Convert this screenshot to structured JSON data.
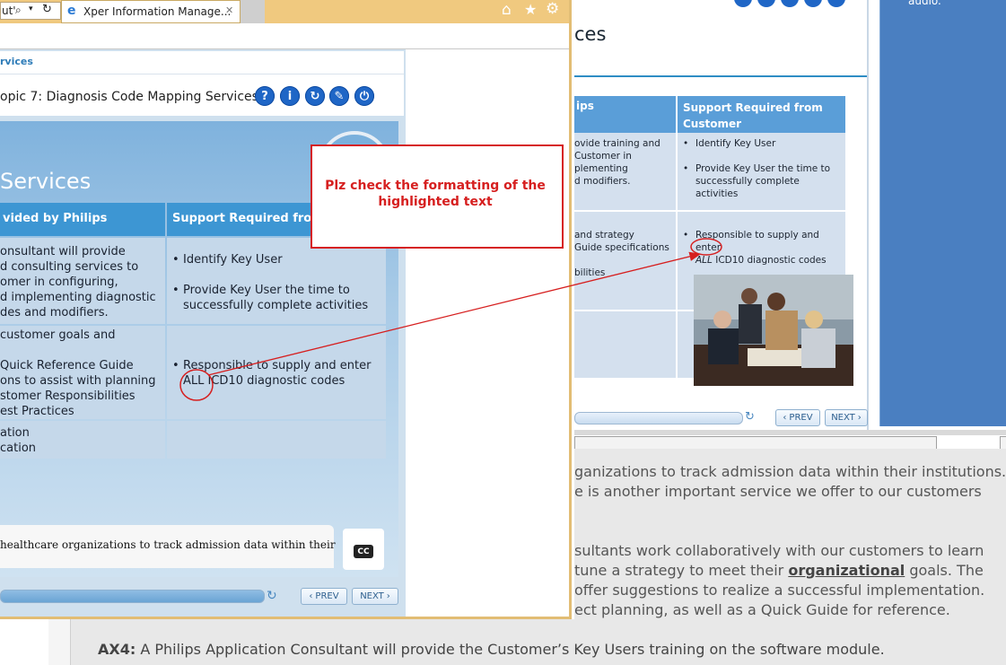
{
  "browser": {
    "address_snippet": "ut'",
    "tab_title": "Xper Information Manage...",
    "tab_close": "✕"
  },
  "course": {
    "breadcrumb": "rvices",
    "topic_title": "opic 7: Diagnosis Code Mapping Services",
    "slide_title": "Services",
    "table": {
      "col1_header": "vided by Philips",
      "col2_header": "Support Required from",
      "row1_col1": [
        "onsultant will provide",
        "d consulting services to",
        "omer in configuring,",
        "d implementing diagnostic",
        "des and modifiers."
      ],
      "row1_col2_bullets": [
        "Identify Key User",
        "Provide Key User the time to successfully complete activities"
      ],
      "row2_col1": [
        "customer goals and",
        "",
        "Quick Reference Guide",
        "ons to assist with planning",
        "stomer Responsibilities",
        "est Practices"
      ],
      "row2_col2_bullets": [
        "Responsible to supply and enter ALL ICD10 diagnostic codes"
      ],
      "row3_col1": [
        "ation",
        "cation"
      ]
    },
    "caption": "healthcare organizations to track admission data within their",
    "cc_label": "CC",
    "prev_label": "PREV",
    "next_label": "NEXT",
    "player_buttons": [
      "?",
      "i",
      "↻",
      "✎",
      "⏻"
    ]
  },
  "background_page": {
    "title_fragment": "ces",
    "right_panel_text": "audio.",
    "table": {
      "col1_header": "ips",
      "col2_header": "Support Required from Customer",
      "row1_col1": [
        "ovide training and",
        "Customer in",
        "plementing",
        "d modifiers."
      ],
      "row1_col2_bullets": [
        "Identify Key User",
        "Provide Key User the time to successfully complete activities"
      ],
      "row2_col1": [
        "and strategy",
        "Guide specifications",
        "",
        "bilities"
      ],
      "row2_col2_bullet": "Responsible to supply and enter",
      "row2_col2_line2_italic": "ALL",
      "row2_col2_line2_rest": " ICD10 diagnostic codes"
    },
    "prev_label": "PREV",
    "next_label": "NEXT",
    "lower_text": [
      "ganizations to track admission data within their institutions.",
      "e is another important service we offer to our customers",
      "sultants work collaboratively with our customers to learn",
      "offer suggestions to realize a successful implementation.",
      "ect planning, as well as a Quick Guide for reference."
    ],
    "lower_line4_pre": "tune a strategy to meet their ",
    "lower_line4_bold": "organizational",
    "lower_line4_post": " goals. The",
    "ax4_label": "AX4:",
    "ax4_text": " A Philips Application Consultant will provide the Customer’s Key Users training on the software module."
  },
  "annotation": {
    "note": "Plz check the formatting of the highlighted text",
    "color": "#d61f1f"
  }
}
